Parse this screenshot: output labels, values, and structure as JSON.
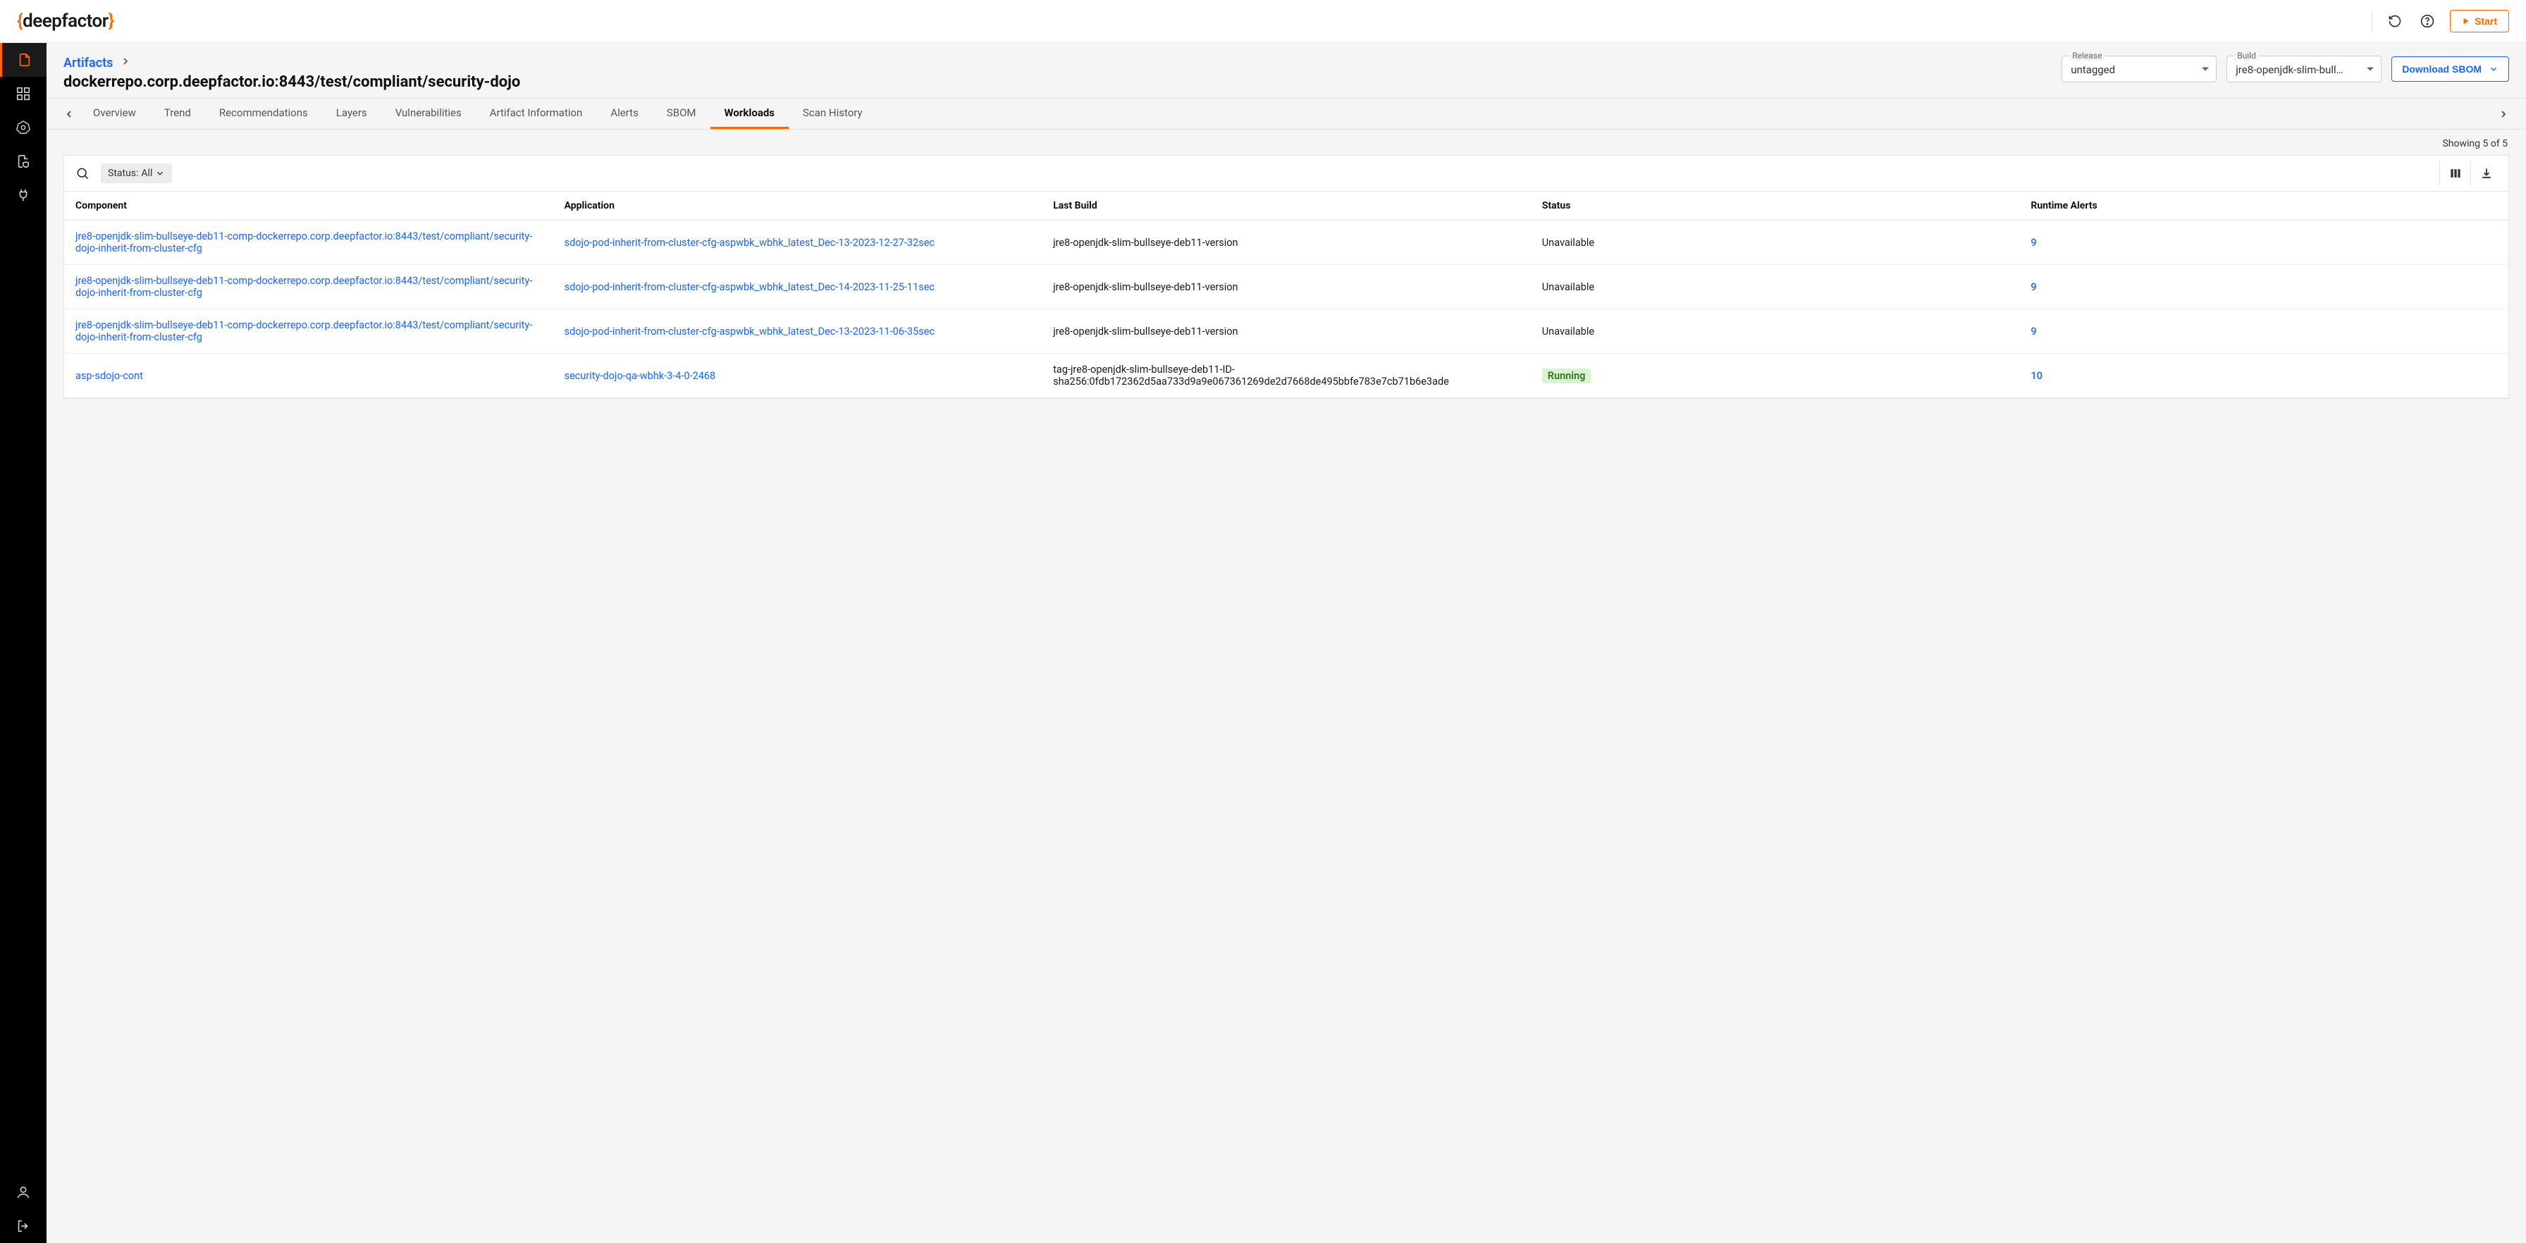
{
  "brand": {
    "name": "deepfactor"
  },
  "topbar": {
    "start_label": "Start"
  },
  "breadcrumb": {
    "parent": "Artifacts"
  },
  "page_title": "dockerrepo.corp.deepfactor.io:8443/test/compliant/security-dojo",
  "selects": {
    "release": {
      "label": "Release",
      "value": "untagged"
    },
    "build": {
      "label": "Build",
      "value": "jre8-openjdk-slim-bull…"
    }
  },
  "download_sbom_label": "Download SBOM",
  "tabs": [
    {
      "label": "Overview",
      "active": false
    },
    {
      "label": "Trend",
      "active": false
    },
    {
      "label": "Recommendations",
      "active": false
    },
    {
      "label": "Layers",
      "active": false
    },
    {
      "label": "Vulnerabilities",
      "active": false
    },
    {
      "label": "Artifact Information",
      "active": false
    },
    {
      "label": "Alerts",
      "active": false
    },
    {
      "label": "SBOM",
      "active": false
    },
    {
      "label": "Workloads",
      "active": true
    },
    {
      "label": "Scan History",
      "active": false
    }
  ],
  "showing_text": "Showing 5 of 5",
  "filter_chip": {
    "label": "Status:",
    "value": "All"
  },
  "columns": {
    "component": "Component",
    "application": "Application",
    "last_build": "Last Build",
    "status": "Status",
    "runtime_alerts": "Runtime Alerts"
  },
  "rows": [
    {
      "component": "jre8-openjdk-slim-bullseye-deb11-comp-dockerrepo.corp.deepfactor.io:8443/test/compliant/security-dojo-inherit-from-cluster-cfg",
      "application": "sdojo-pod-inherit-from-cluster-cfg-aspwbk_wbhk_latest_Dec-13-2023-12-27-32sec",
      "last_build": "jre8-openjdk-slim-bullseye-deb11-version",
      "status": "Unavailable",
      "status_style": "plain",
      "alerts": "9"
    },
    {
      "component": "jre8-openjdk-slim-bullseye-deb11-comp-dockerrepo.corp.deepfactor.io:8443/test/compliant/security-dojo-inherit-from-cluster-cfg",
      "application": "sdojo-pod-inherit-from-cluster-cfg-aspwbk_wbhk_latest_Dec-14-2023-11-25-11sec",
      "last_build": "jre8-openjdk-slim-bullseye-deb11-version",
      "status": "Unavailable",
      "status_style": "plain",
      "alerts": "9"
    },
    {
      "component": "jre8-openjdk-slim-bullseye-deb11-comp-dockerrepo.corp.deepfactor.io:8443/test/compliant/security-dojo-inherit-from-cluster-cfg",
      "application": "sdojo-pod-inherit-from-cluster-cfg-aspwbk_wbhk_latest_Dec-13-2023-11-06-35sec",
      "last_build": "jre8-openjdk-slim-bullseye-deb11-version",
      "status": "Unavailable",
      "status_style": "plain",
      "alerts": "9"
    },
    {
      "component": "asp-sdojo-cont",
      "application": "security-dojo-qa-wbhk-3-4-0-2468",
      "last_build": "tag-jre8-openjdk-slim-bullseye-deb11-ID-sha256:0fdb172362d5aa733d9a9e067361269de2d7668de495bbfe783e7cb71b6e3ade",
      "status": "Running",
      "status_style": "running",
      "alerts": "10"
    }
  ]
}
